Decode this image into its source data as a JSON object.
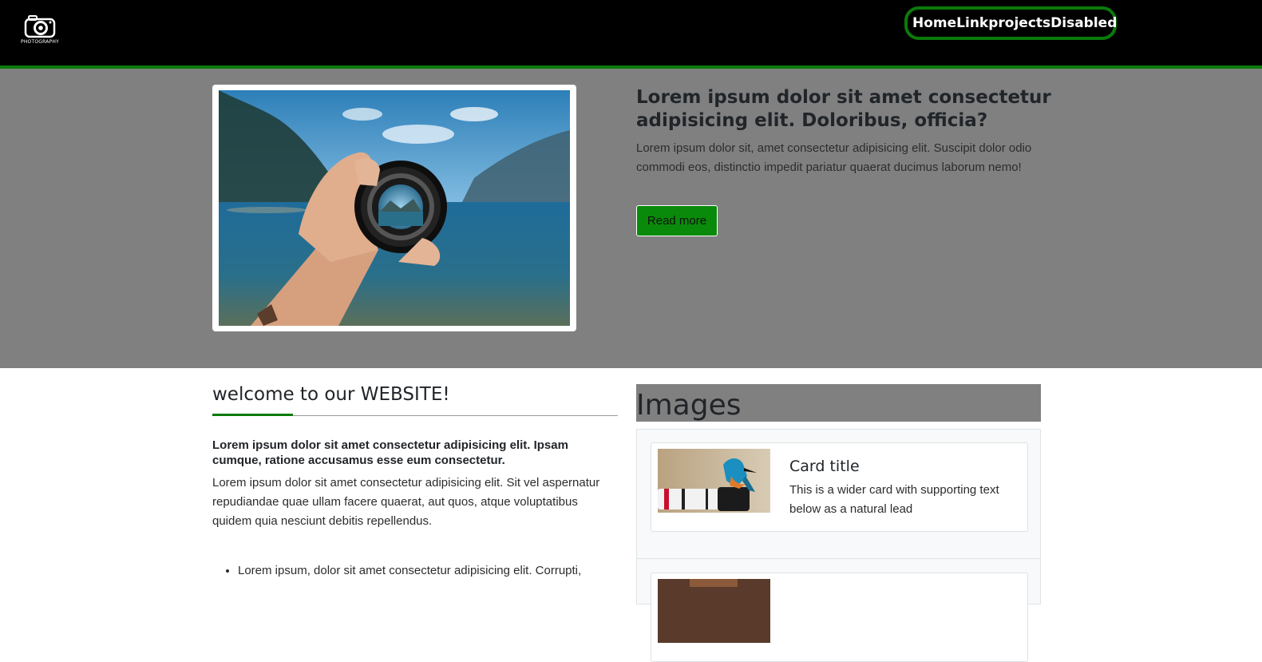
{
  "navbar": {
    "logo_text": "PHOTOGRAPHY",
    "links": [
      "Home",
      "Link",
      "projects",
      "Disabled"
    ],
    "accent": "#0a7a0a"
  },
  "hero": {
    "title": "Lorem ipsum dolor sit amet consectetur adipisicing elit. Doloribus, officia?",
    "text": "Lorem ipsum dolor sit, amet consectetur adipisicing elit. Suscipit dolor odio commodi eos, distinctio impedit pariatur quaerat ducimus laborum nemo!",
    "button_label": "Read more",
    "background": "#808080"
  },
  "welcome": {
    "title": "welcome to our WEBSITE!",
    "bold_text": "Lorem ipsum dolor sit amet consectetur adipisicing elit. Ipsam cumque, ratione accusamus esse eum consectetur.",
    "text": "Lorem ipsum dolor sit amet consectetur adipisicing elit. Sit vel aspernatur repudiandae quae ullam facere quaerat, aut quos, atque voluptatibus quidem quia nesciunt debitis repellendus.",
    "list": [
      "Lorem ipsum, dolor sit amet consectetur adipisicing elit. Corrupti,"
    ]
  },
  "images": {
    "heading": "Images",
    "cards": [
      {
        "title": "Card title",
        "text": "This is a wider card with supporting text below as a natural lead"
      }
    ]
  }
}
